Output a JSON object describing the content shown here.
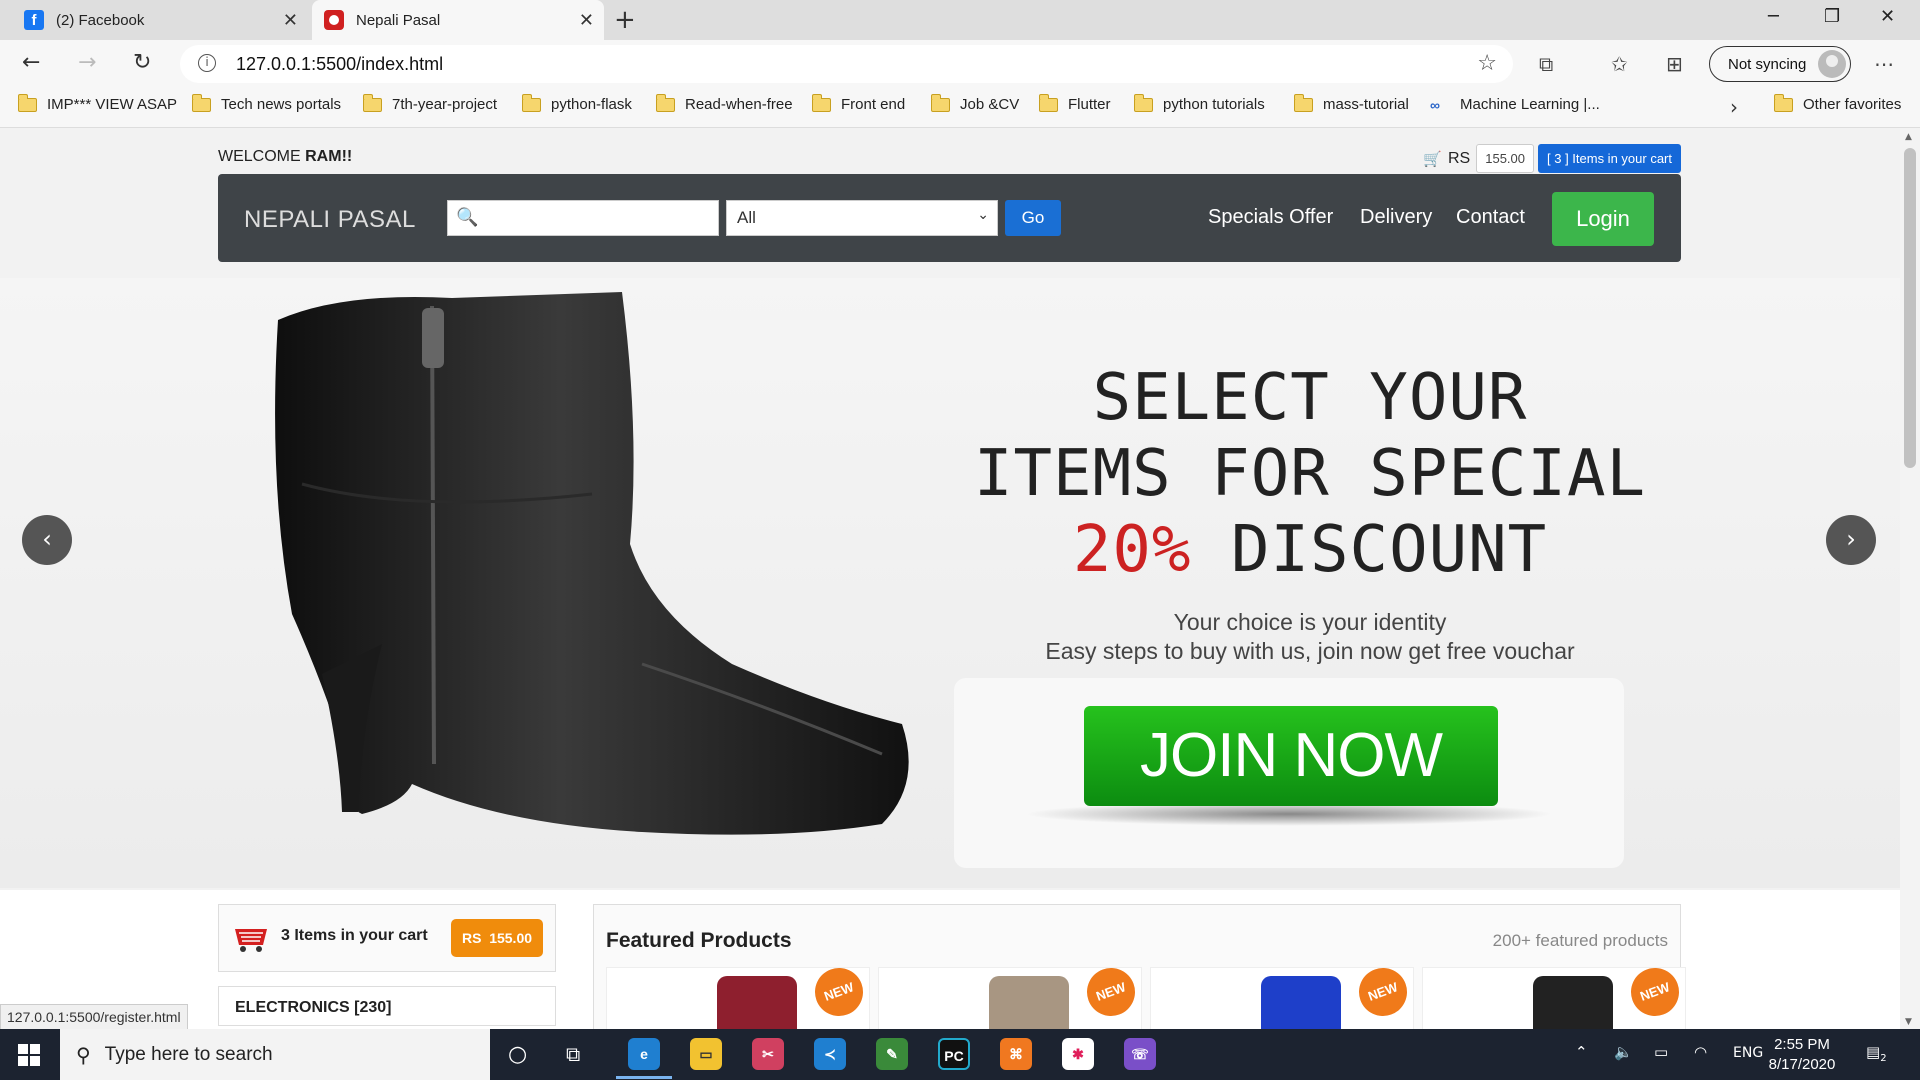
{
  "browser": {
    "tabs": [
      {
        "title": "(2) Facebook",
        "icon": "facebook-icon"
      },
      {
        "title": "Nepali Pasal",
        "icon": "nepali-pasal-icon"
      }
    ],
    "url": "127.0.0.1:5500/index.html",
    "sync_label": "Not syncing",
    "bookmarks": [
      "IMP*** VIEW ASAP",
      "Tech news portals",
      "7th-year-project",
      "python-flask",
      "Read-when-free",
      "Front end",
      "Job &CV",
      "Flutter",
      "python tutorials",
      "mass-tutorial",
      "Machine Learning |...",
      "Other favorites"
    ],
    "status_link": "127.0.0.1:5500/register.html"
  },
  "site": {
    "welcome_prefix": "WELCOME ",
    "welcome_user": "RAM!!",
    "currency": "RS",
    "cart_amount": "155.00",
    "cart_items_badge": "[ 3 ] Items in your cart",
    "brand": "NEPALI PASAL",
    "search_placeholder": "",
    "category_selected": "All",
    "go_label": "Go",
    "nav": [
      "Specials Offer",
      "Delivery",
      "Contact"
    ],
    "login_label": "Login"
  },
  "hero": {
    "line1": "SELECT YOUR",
    "line2": "ITEMS FOR SPECIAL",
    "discount": "20%",
    "line3_rest": " DISCOUNT",
    "sub1": "Your choice is your identity",
    "sub2": "Easy steps to buy with us, join now get free vouchar",
    "join_label": "JOIN NOW"
  },
  "sidebar": {
    "cart_text": "3 Items in your cart",
    "cart_price": "RS  155.00",
    "category": "ELECTRONICS [230]"
  },
  "featured": {
    "title": "Featured Products",
    "count": "200+ featured products",
    "badge": "NEW",
    "products": [
      {
        "color": "#8e1f2e"
      },
      {
        "color": "#a89682"
      },
      {
        "color": "#1e3fc9"
      },
      {
        "color": "#222222"
      }
    ]
  },
  "taskbar": {
    "search_placeholder": "Type here to search",
    "lang": "ENG",
    "time": "2:55 PM",
    "date": "8/17/2020",
    "notifications": "2"
  }
}
